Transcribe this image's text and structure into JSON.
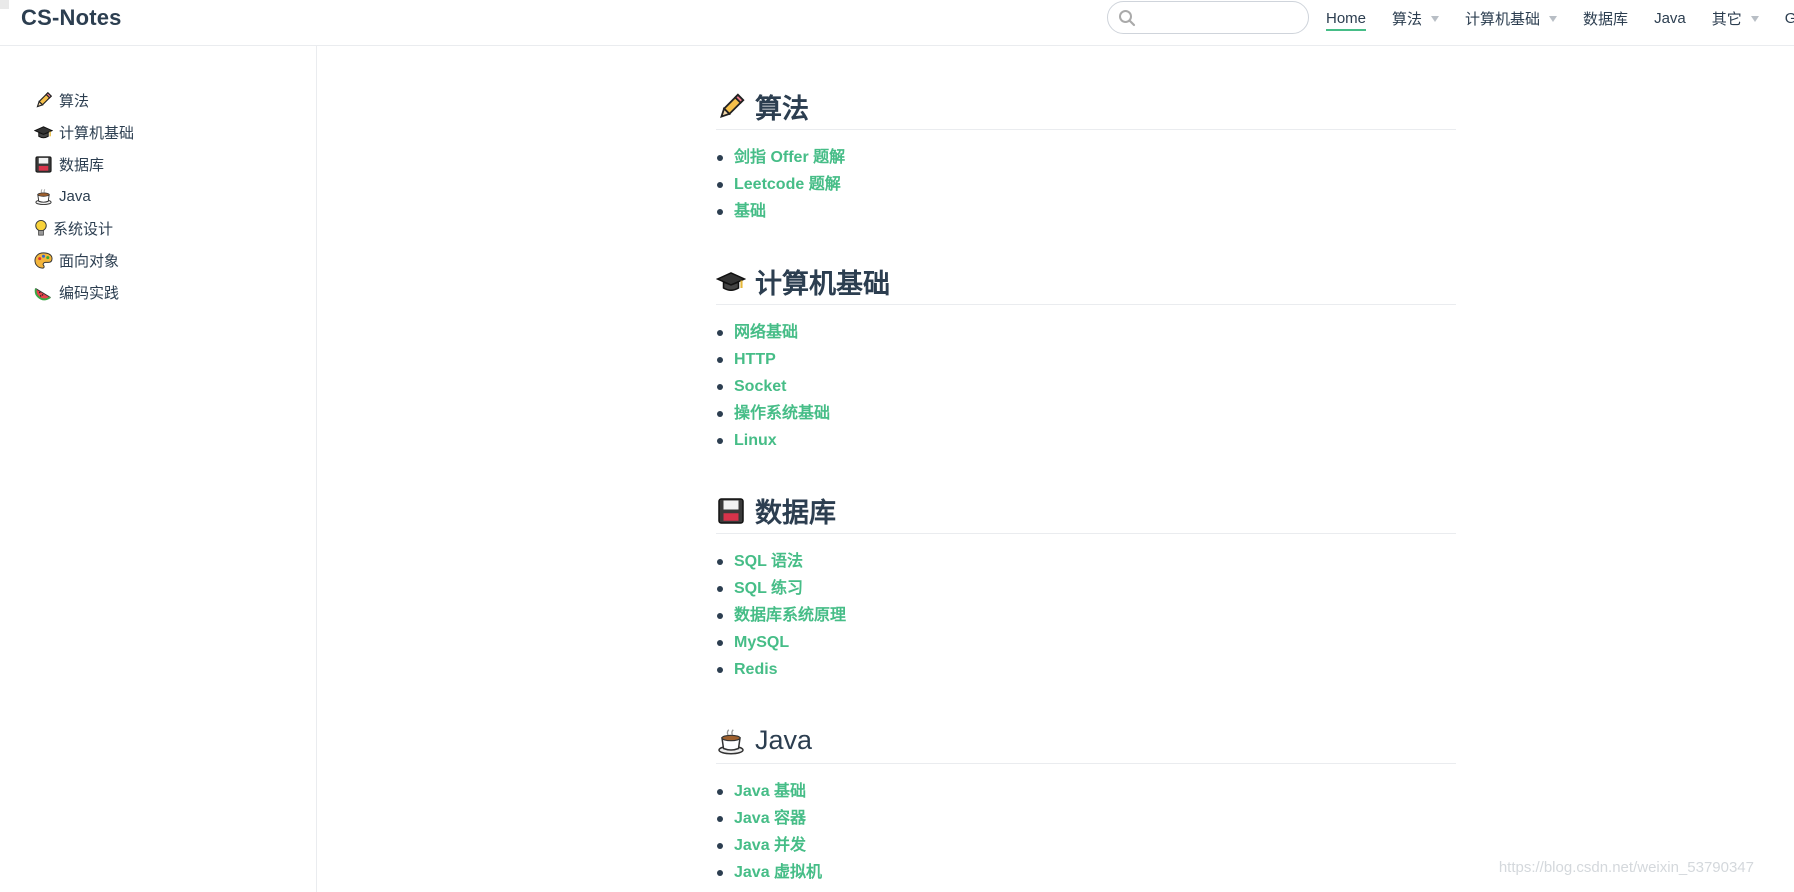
{
  "site": {
    "name": "CS-Notes"
  },
  "search": {
    "placeholder": "",
    "value": ""
  },
  "nav": {
    "items": [
      {
        "label": "Home",
        "active": true,
        "dropdown": false
      },
      {
        "label": "算法",
        "active": false,
        "dropdown": true
      },
      {
        "label": "计算机基础",
        "active": false,
        "dropdown": true
      },
      {
        "label": "数据库",
        "active": false,
        "dropdown": false
      },
      {
        "label": "Java",
        "active": false,
        "dropdown": false
      },
      {
        "label": "其它",
        "active": false,
        "dropdown": true
      },
      {
        "label": "Github",
        "active": false,
        "dropdown": false
      }
    ]
  },
  "sidebar": {
    "items": [
      {
        "label": "算法",
        "icon": "pencil-icon"
      },
      {
        "label": "计算机基础",
        "icon": "graduation-cap-icon"
      },
      {
        "label": "数据库",
        "icon": "floppy-disk-icon"
      },
      {
        "label": "Java",
        "icon": "coffee-icon"
      },
      {
        "label": "系统设计",
        "icon": "lightbulb-icon"
      },
      {
        "label": "面向对象",
        "icon": "palette-icon"
      },
      {
        "label": "编码实践",
        "icon": "watermelon-icon"
      }
    ]
  },
  "main": {
    "sections": [
      {
        "title": "算法",
        "icon": "pencil-icon",
        "links": [
          "剑指 Offer 题解",
          "Leetcode 题解",
          "基础"
        ]
      },
      {
        "title": "计算机基础",
        "icon": "graduation-cap-icon",
        "links": [
          "网络基础",
          "HTTP",
          "Socket",
          "操作系统基础",
          "Linux"
        ]
      },
      {
        "title": "数据库",
        "icon": "floppy-disk-icon",
        "links": [
          "SQL 语法",
          "SQL 练习",
          "数据库系统原理",
          "MySQL",
          "Redis"
        ]
      },
      {
        "title": "Java",
        "icon": "coffee-icon",
        "links": [
          "Java 基础",
          "Java 容器",
          "Java 并发",
          "Java 虚拟机"
        ]
      }
    ]
  },
  "watermark": "https://blog.csdn.net/weixin_53790347",
  "colors": {
    "text": "#2c3e50",
    "accent": "#46bd87",
    "border": "#eaecef"
  }
}
